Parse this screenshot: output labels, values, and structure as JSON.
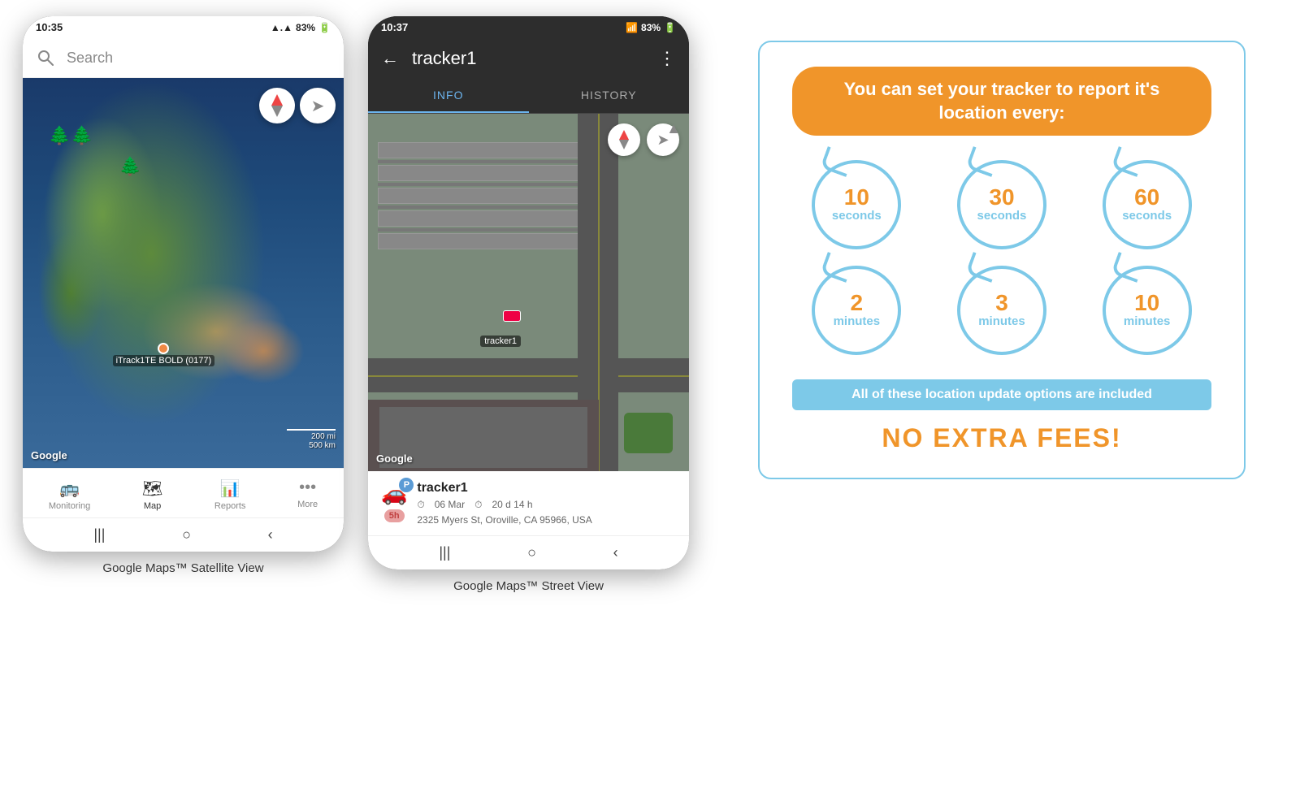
{
  "phone1": {
    "status_time": "10:35",
    "status_signal": "▲▲▲",
    "status_battery": "83%",
    "search_placeholder": "Search",
    "map_label": "iTrack1TE BOLD (0177)",
    "google_watermark": "Google",
    "scale_200mi": "200 mi",
    "scale_500km": "500 km",
    "nav_monitoring": "Monitoring",
    "nav_map": "Map",
    "nav_reports": "Reports",
    "nav_more": "More"
  },
  "phone2": {
    "status_time": "10:37",
    "status_signal": "▲▲▲",
    "status_battery": "83%",
    "tracker_title": "tracker1",
    "tab_info": "INFO",
    "tab_history": "HISTORY",
    "google_watermark": "Google",
    "tracker_name": "tracker1",
    "date": "06 Mar",
    "duration": "20 d 14 h",
    "address": "2325 Myers St, Oroville, CA 95966, USA",
    "badge_5h": "5h",
    "parking_label": "tracker1"
  },
  "promo": {
    "headline": "You can set your tracker to report it's location every:",
    "circles": [
      {
        "number": "10",
        "unit": "seconds"
      },
      {
        "number": "30",
        "unit": "seconds"
      },
      {
        "number": "60",
        "unit": "seconds"
      },
      {
        "number": "2",
        "unit": "minutes"
      },
      {
        "number": "3",
        "unit": "minutes"
      },
      {
        "number": "10",
        "unit": "minutes"
      }
    ],
    "included_text": "All of these location update options are included",
    "no_extra_fees": "NO EXTRA FEES!"
  },
  "captions": {
    "caption1": "Google Maps™ Satellite View",
    "caption2": "Google Maps™ Street View"
  }
}
